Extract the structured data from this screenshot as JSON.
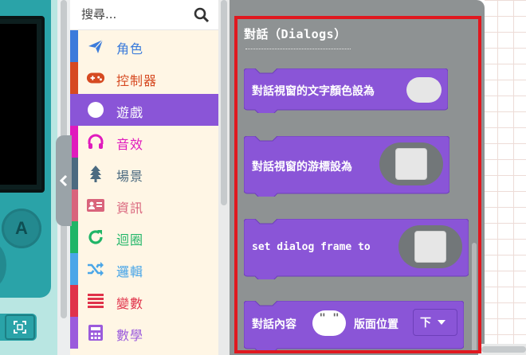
{
  "simulator": {
    "a_button_label": "A"
  },
  "toolbox": {
    "search_placeholder": "搜尋...",
    "categories": [
      {
        "label": "角色",
        "color": "#3b7bdb",
        "icon": "paper-plane-icon"
      },
      {
        "label": "控制器",
        "color": "#d64a21",
        "icon": "gamepad-icon"
      },
      {
        "label": "遊戲",
        "color": "#8a55d7",
        "icon": "circle-icon",
        "selected": true
      },
      {
        "label": "音效",
        "color": "#e01bbd",
        "icon": "headphones-icon"
      },
      {
        "label": "場景",
        "color": "#4b6a80",
        "icon": "tree-icon"
      },
      {
        "label": "資訊",
        "color": "#d9647c",
        "icon": "id-card-icon"
      },
      {
        "label": "迴圈",
        "color": "#1fb567",
        "icon": "refresh-icon"
      },
      {
        "label": "邏輯",
        "color": "#4aa6e8",
        "icon": "shuffle-icon"
      },
      {
        "label": "變數",
        "color": "#e0324a",
        "icon": "list-icon"
      },
      {
        "label": "數學",
        "color": "#9b5bdc",
        "icon": "calculator-icon"
      }
    ]
  },
  "flyout": {
    "title": "對話（Dialogs）",
    "blocks": [
      {
        "text": "對話視窗的文字顏色設為"
      },
      {
        "text": "對話視窗的游標設為"
      },
      {
        "text": "set dialog frame to"
      },
      {
        "text": "對話內容",
        "string_value": "\" \"",
        "text2": "版面位置",
        "dropdown_value": "下"
      }
    ]
  },
  "colors": {
    "block_purple": "#8a55d7",
    "flyout_bg": "#8e9293",
    "highlight": "#e0181f"
  }
}
